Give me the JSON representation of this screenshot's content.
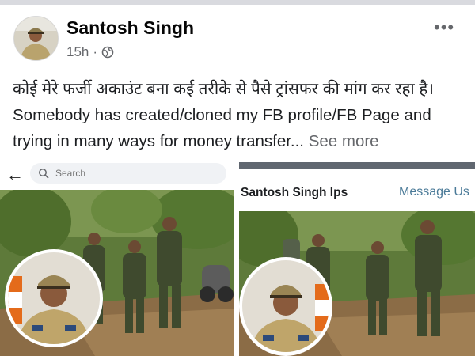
{
  "post": {
    "author": "Santosh Singh",
    "time": "15h",
    "more_label": "•••",
    "text_hindi": "कोई मेरे फर्जी अकाउंट बना कई तरीके से पैसे ट्रांसफर की मांग कर रहा है। ",
    "text_english": "Somebody has created/cloned my FB profile/FB Page and trying in many ways for money transfer... ",
    "see_more": "See more"
  },
  "left_screenshot": {
    "back_icon": "back-arrow-icon",
    "search_placeholder": "Search"
  },
  "right_screenshot": {
    "page_name": "Santosh Singh Ips",
    "message_label": "Message Us"
  },
  "colors": {
    "secondary_text": "#65676b",
    "message_link": "#4a7a98",
    "top_bar": "#606770"
  }
}
